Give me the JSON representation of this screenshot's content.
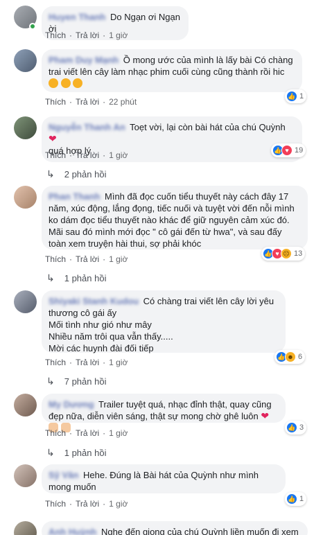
{
  "actions": {
    "like": "Thích",
    "reply": "Trả lời",
    "dot": "·"
  },
  "comments": [
    {
      "author": "Huyen Thanh",
      "text": "Do Ngạn ơi Ngạn ời",
      "time": "1 giờ",
      "avatar_color": "#8a8f96",
      "online": true
    },
    {
      "author": "Pham Duy Mạnh",
      "text": "Ồ mong ước của mình là lấy bài Có chàng trai viết lên cây làm nhạc phim cuối cùng cũng thành rồi hic",
      "time": "22 phút",
      "reaction_count": "1",
      "avatar_color": "#6f7f97"
    },
    {
      "author": "Nguyễn Thanh An",
      "text": "Toẹt vời, lại còn bài hát của chú Quỳnh",
      "text2": "quá hợp lý",
      "time": "1 giờ",
      "reaction_count": "19",
      "replies": "2 phản hồi",
      "avatar_color": "#5d6e5a"
    },
    {
      "author": "Phan Thanh",
      "text": "Mình đã đọc cuốn tiểu thuyết này cách đây 17 năm, xúc động, lắng đọng, tiếc nuối và tuyệt vời đến nỗi mình ko dám đọc tiểu thuyết nào khác để giữ nguyên cảm xúc đó. Mãi sau đó mình mới đọc \" cô gái đến từ hwa\", và sau đấy toàn xem truyện hài thui, sợ phải khóc",
      "time": "1 giờ",
      "reaction_count": "13",
      "replies": "1 phản hồi",
      "avatar_color": "#c9a38a"
    },
    {
      "author": "Shiyaki Stanh Kudou",
      "text_lines": [
        "Có chàng trai viết lên cây lời yêu",
        "thương cô gái ấy",
        "Mối tình như gió như mây",
        "Nhiều năm trôi qua vẫn thấy.....",
        "Mời các huynh đài đối tiếp"
      ],
      "time": "1 giờ",
      "reaction_count": "6",
      "replies": "7 phản hồi",
      "avatar_color": "#7d8596"
    },
    {
      "author": "My Dương",
      "text": "Trailer tuyệt quá, nhạc đỉnh thật, quay cũng đẹp nữa, diễn viên sáng, thật sự mong chờ ghê luôn",
      "time": "1 giờ",
      "reaction_count": "3",
      "replies": "1 phản hồi",
      "avatar_color": "#9a8478"
    },
    {
      "author": "Sỹ Văn",
      "text": "Hehe. Đúng là Bài hát của Quỳnh như mình mong muốn",
      "time": "1 giờ",
      "reaction_count": "1",
      "avatar_color": "#a0928a"
    },
    {
      "author": "Anh Huỳnh",
      "text": "Nghe đến giọng của chú Quỳnh liền muốn đi xem",
      "avatar_color": "#8b8578"
    }
  ]
}
